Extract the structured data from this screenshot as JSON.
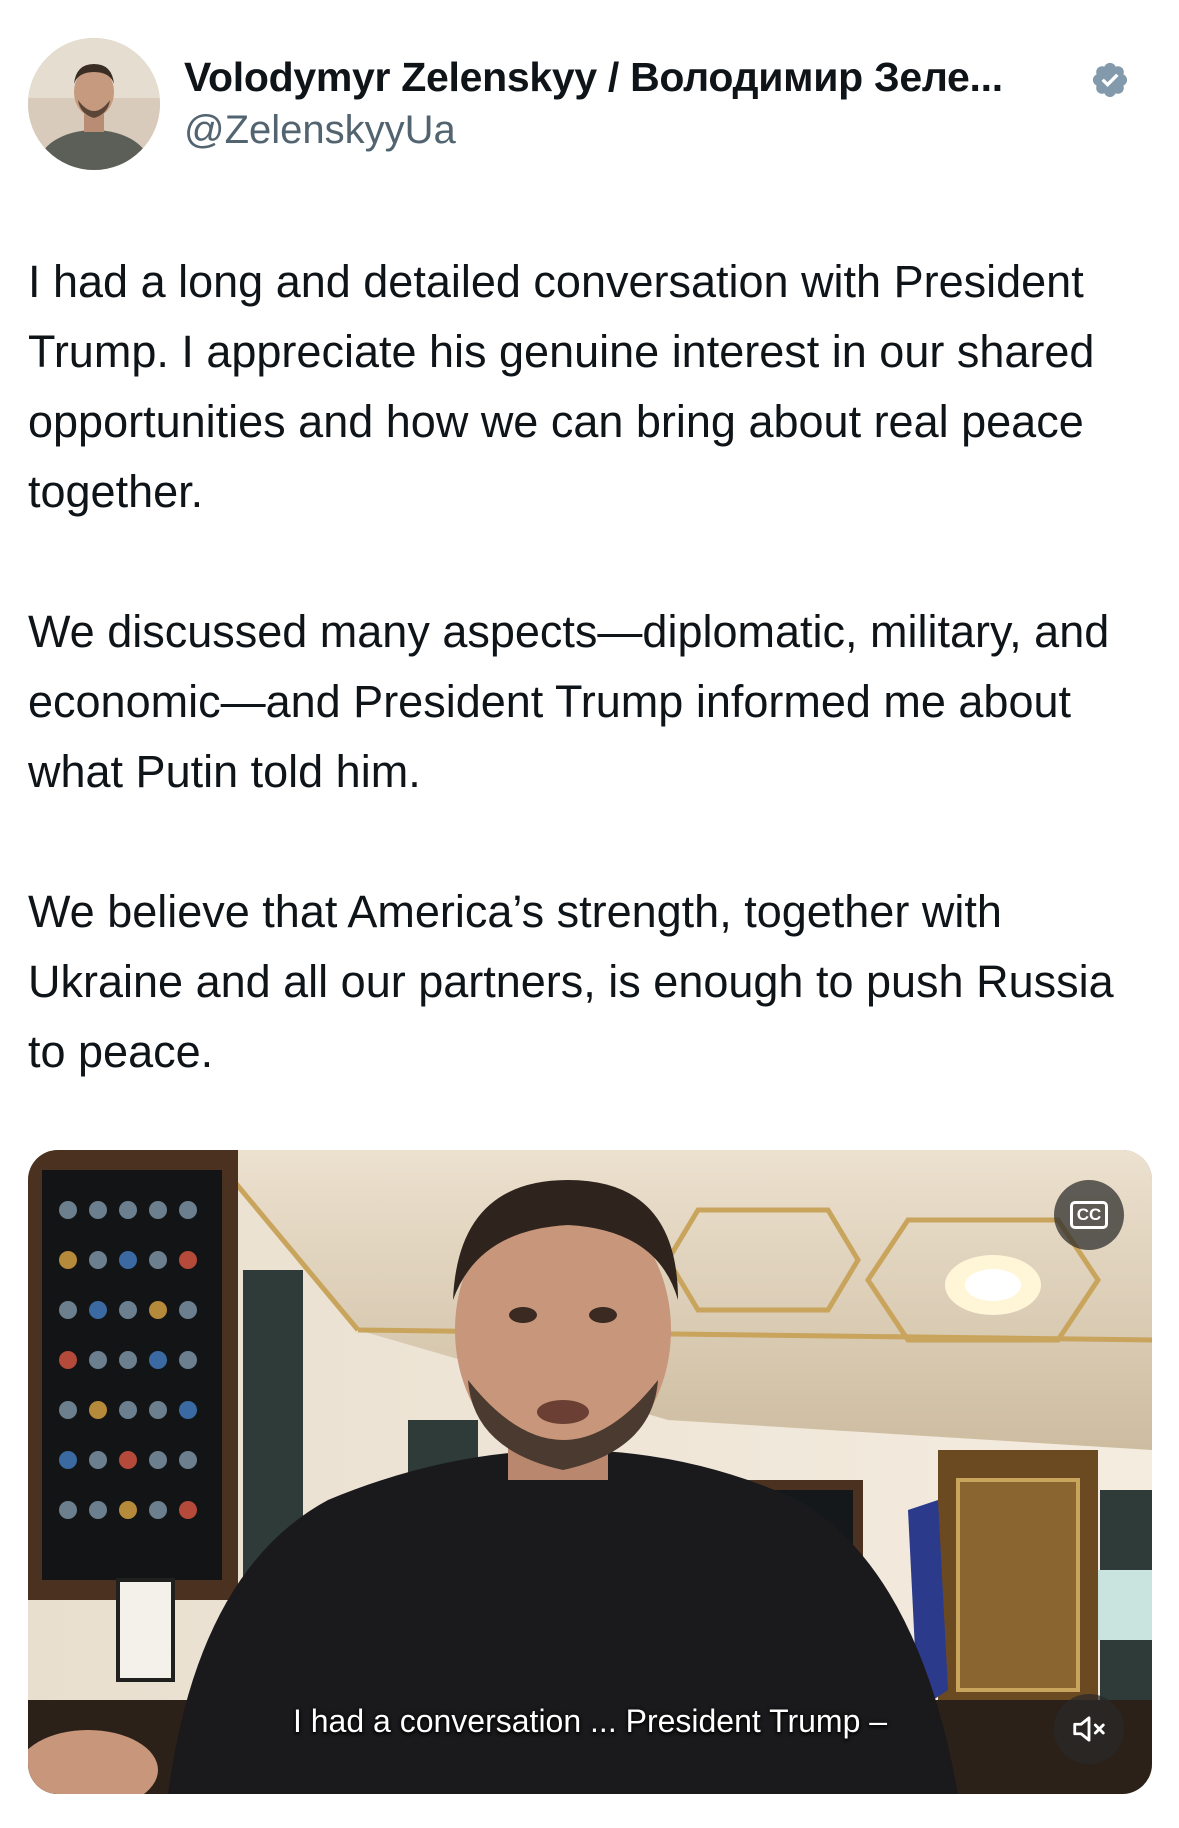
{
  "author": {
    "display_name": "Volodymyr Zelenskyy / Володимир Зеле...",
    "handle": "@ZelenskyyUa",
    "avatar_icon": "profile-photo",
    "verified_icon": "verified-badge-icon",
    "verified_color": "#829aab"
  },
  "tweet": {
    "paragraphs": [
      "I had a long and detailed conversation with President Trump. I appreciate his genuine interest in our shared opportunities and how we can bring about real peace together.",
      "We discussed many aspects—diplomatic, military, and economic—and President Trump informed me about what Putin told him.",
      "We believe that America’s strength, together with Ukraine and all our partners, is enough to push Russia to peace."
    ]
  },
  "media": {
    "type": "video",
    "caption_button_label": "CC",
    "subtitle": "I had a conversation ... President Trump –",
    "mute_icon": "speaker-muted-icon"
  },
  "colors": {
    "text": "#0f1419",
    "secondary": "#536471"
  }
}
